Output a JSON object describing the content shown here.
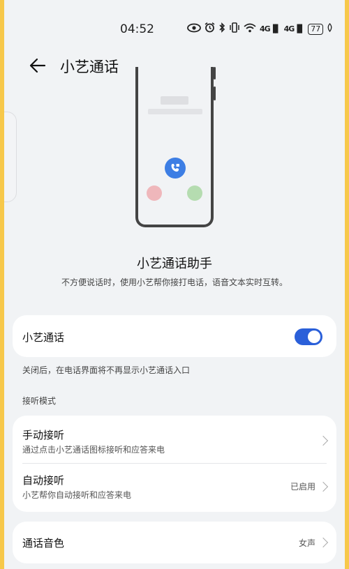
{
  "status_bar": {
    "time": "04:52",
    "signal1": "4G",
    "signal2": "4G",
    "battery": "77"
  },
  "header": {
    "title": "小艺通话"
  },
  "feature": {
    "title": "小艺通话助手",
    "description": "不方便说话时，使用小艺帮你接打电话，语音文本实时互转。"
  },
  "toggle_card": {
    "label": "小艺通话",
    "enabled": true,
    "note": "关闭后，在电话界面将不再显示小艺通话入口"
  },
  "section_label": "接听模式",
  "answer_modes": [
    {
      "title": "手动接听",
      "subtitle": "通过点击小艺通话图标接听和应答来电",
      "value": ""
    },
    {
      "title": "自动接听",
      "subtitle": "小艺帮你自动接听和应答来电",
      "value": "已启用"
    }
  ],
  "voice_card": {
    "title": "通话音色",
    "value": "女声"
  },
  "colors": {
    "accent": "#2a5fd9",
    "background": "#f1f3f5",
    "frame": "#f7c84a"
  }
}
